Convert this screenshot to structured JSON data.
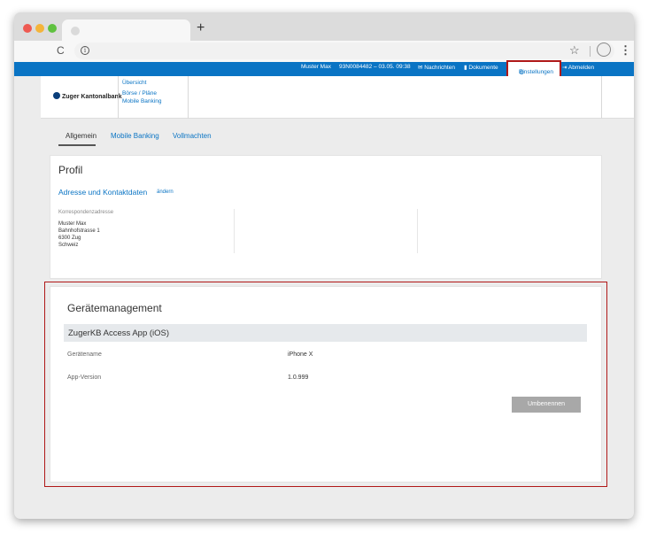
{
  "browser": {
    "new_tab_icon": "plus-icon",
    "reload_icon": "reload-icon",
    "info_icon": "info-icon",
    "bookmark_icon": "star-icon",
    "menu_icon": "kebab-menu-icon"
  },
  "topbar": {
    "user": "Muster Max",
    "session": "93N0084482 – 03.05. 09:38",
    "messages": "Nachrichten",
    "documents": "Dokumente",
    "settings": "Einstellungen",
    "logout": "Abmelden"
  },
  "header": {
    "logo_text": "Zuger Kantonalbank",
    "nav": [
      "Übersicht",
      "Börse / Pläne",
      "Mobile Banking"
    ]
  },
  "tabs": [
    "Allgemein",
    "Mobile Banking",
    "Vollmachten"
  ],
  "profile": {
    "title": "Profil",
    "section": "Adresse und Kontaktdaten",
    "edit": "ändern",
    "address_label": "Korrespondenzadresse",
    "address_lines": [
      "Muster Max",
      "Bahnhofstrasse 1",
      "6300 Zug",
      "Schweiz"
    ]
  },
  "devices": {
    "title": "Gerätemanagement",
    "app": "ZugerKB Access App (iOS)",
    "rows": [
      {
        "label": "Gerätename",
        "value": "iPhone X"
      },
      {
        "label": "App-Version",
        "value": "1.0.999"
      }
    ],
    "rename_button": "Umbenennen"
  },
  "colors": {
    "brand_blue": "#0a74c4",
    "highlight_red": "#b01818",
    "button_gray": "#a8a8a8"
  }
}
